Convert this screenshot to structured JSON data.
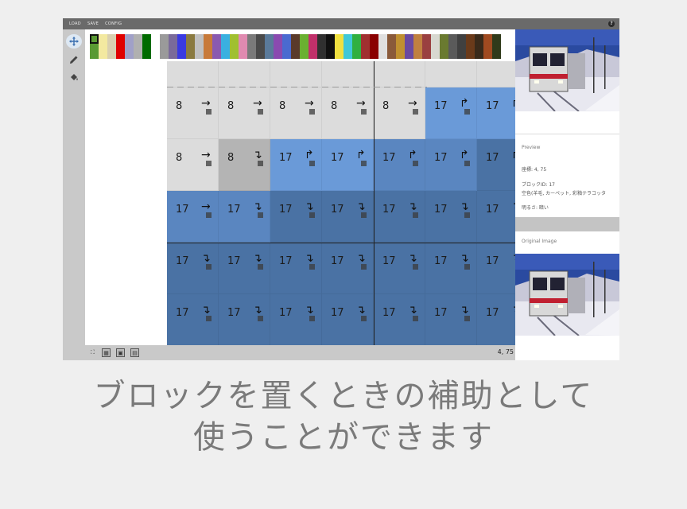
{
  "menu": {
    "load": "LOAD",
    "save": "SAVE",
    "config": "CONFIG",
    "help": "?"
  },
  "tools": [
    "move-tool",
    "pencil-tool",
    "bucket-tool"
  ],
  "palette_colors": [
    "#5a9a33",
    "#f3e9a0",
    "#d9d0b0",
    "#e00000",
    "#a0a0c8",
    "#b0b0b0",
    "#006b00",
    "#ffffff",
    "#9a9a9a",
    "#7a6a9a",
    "#3a3ae0",
    "#8a7a40",
    "#c0c0c0",
    "#c87a3a",
    "#8a5ab0",
    "#3ab0e0",
    "#a0c030",
    "#e08ab0",
    "#7a7a7a",
    "#4a4a4a",
    "#5a7a9a",
    "#8a4ab0",
    "#4a6ad0",
    "#5a3a2a",
    "#6ab030",
    "#c0306a",
    "#303030",
    "#101010",
    "#f0e040",
    "#40c8d8",
    "#30b040",
    "#a03030",
    "#8a0000",
    "#e0e0e0",
    "#8a5a3a",
    "#c09030",
    "#6a4aa0",
    "#c08040",
    "#9a4040",
    "#d8d8d0",
    "#6a7a30",
    "#5a5a5a",
    "#404040",
    "#6a3a1a",
    "#3a2a1a",
    "#a04a20",
    "#303a1a"
  ],
  "grid": {
    "rows": [
      [
        {
          "id": "",
          "g": ""
        },
        {
          "id": "",
          "g": ""
        },
        {
          "id": "",
          "g": ""
        },
        {
          "id": "",
          "g": ""
        },
        {
          "id": "",
          "g": ""
        },
        {
          "id": "",
          "g": ""
        },
        {
          "id": "",
          "g": ""
        }
      ],
      [
        {
          "id": "8",
          "g": "→"
        },
        {
          "id": "8",
          "g": "→"
        },
        {
          "id": "8",
          "g": "→"
        },
        {
          "id": "8",
          "g": "→"
        },
        {
          "id": "8",
          "g": "→"
        },
        {
          "id": "17",
          "g": "↱"
        },
        {
          "id": "17",
          "g": "↱"
        }
      ],
      [
        {
          "id": "8",
          "g": "→"
        },
        {
          "id": "8",
          "g": "↴"
        },
        {
          "id": "17",
          "g": "↱"
        },
        {
          "id": "17",
          "g": "↱"
        },
        {
          "id": "17",
          "g": "↱"
        },
        {
          "id": "17",
          "g": "↱"
        },
        {
          "id": "17",
          "g": "↱"
        }
      ],
      [
        {
          "id": "17",
          "g": "→"
        },
        {
          "id": "17",
          "g": "↴"
        },
        {
          "id": "17",
          "g": "↴"
        },
        {
          "id": "17",
          "g": "↴"
        },
        {
          "id": "17",
          "g": "↴"
        },
        {
          "id": "17",
          "g": "↴"
        },
        {
          "id": "17",
          "g": "↴"
        }
      ],
      [
        {
          "id": "17",
          "g": "↴"
        },
        {
          "id": "17",
          "g": "↴"
        },
        {
          "id": "17",
          "g": "↴"
        },
        {
          "id": "17",
          "g": "↴"
        },
        {
          "id": "17",
          "g": "↴"
        },
        {
          "id": "17",
          "g": "↴"
        },
        {
          "id": "17",
          "g": "↴"
        }
      ],
      [
        {
          "id": "17",
          "g": "↴"
        },
        {
          "id": "17",
          "g": "↴"
        },
        {
          "id": "17",
          "g": "↴"
        },
        {
          "id": "17",
          "g": "↴"
        },
        {
          "id": "17",
          "g": "↴"
        },
        {
          "id": "17",
          "g": "↴"
        },
        {
          "id": "17",
          "g": "↴"
        }
      ]
    ],
    "colors": [
      [
        "#dcdcdc",
        "#dcdcdc",
        "#dcdcdc",
        "#dcdcdc",
        "#dcdcdc",
        "#dcdcdc",
        "#dcdcdc"
      ],
      [
        "#dcdcdc",
        "#dcdcdc",
        "#dcdcdc",
        "#dcdcdc",
        "#dcdcdc",
        "#6a9ad8",
        "#6a9ad8"
      ],
      [
        "#dcdcdc",
        "#b4b4b4",
        "#6a9ad8",
        "#6a9ad8",
        "#5a86c0",
        "#5a86c0",
        "#4a72a4"
      ],
      [
        "#5a86c0",
        "#5a86c0",
        "#4a72a4",
        "#4a72a4",
        "#4a72a4",
        "#4a72a4",
        "#4a72a4"
      ],
      [
        "#4a72a4",
        "#4a72a4",
        "#4a72a4",
        "#4a72a4",
        "#4a72a4",
        "#4a72a4",
        "#4a72a4"
      ],
      [
        "#4a72a4",
        "#4a72a4",
        "#4a72a4",
        "#4a72a4",
        "#4a72a4",
        "#4a72a4",
        "#4a72a4"
      ]
    ]
  },
  "status": {
    "coords": "4, 75"
  },
  "panel": {
    "preview_label": "Preview",
    "coord_line": "座標: 4, 75",
    "block_id_line": "ブロックID: 17",
    "block_name_line": "空色(羊毛, カーペット, 彩釉テラコッタ",
    "brightness_line": "明るさ: 暗い",
    "original_label": "Original Image"
  },
  "caption": {
    "line1": "ブロックを置くときの補助として",
    "line2": "使うことができます"
  }
}
